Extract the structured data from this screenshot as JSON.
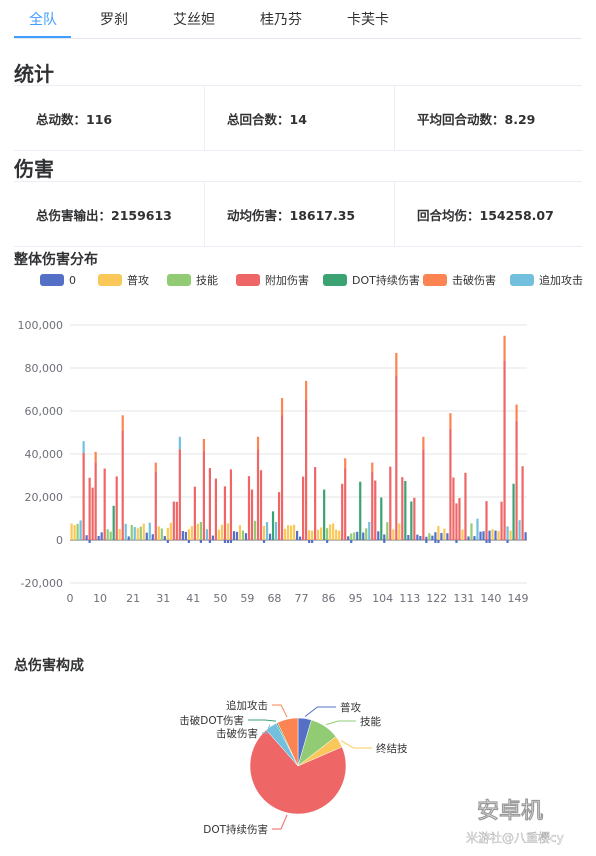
{
  "tabs": [
    "全队",
    "罗刹",
    "艾丝妲",
    "桂乃芬",
    "卡芙卡"
  ],
  "stats_title": "统计",
  "stats": [
    "总动数：116",
    "总回合数：14",
    "平均回合动数：8.29"
  ],
  "damage_title": "伤害",
  "damage_stats": [
    "总伤害输出：2159613",
    "动均伤害：18617.35",
    "回合均伤：154258.07"
  ],
  "bar_title": "整体伤害分布",
  "pie_title": "总伤害构成",
  "watermark": {
    "brand": "安卓机",
    "sub": "米游社@八重樱cy"
  },
  "chart_data": [
    {
      "type": "bar",
      "stacked": true,
      "legend": [
        {
          "name": "0",
          "color": "#5470c6"
        },
        {
          "name": "普攻",
          "color": "#fac858"
        },
        {
          "name": "技能",
          "color": "#91cc75"
        },
        {
          "name": "附加伤害",
          "color": "#ee6666"
        },
        {
          "name": "DOT持续伤害",
          "color": "#3ba272"
        },
        {
          "name": "击破伤害",
          "color": "#fc8452"
        },
        {
          "name": "追加攻击",
          "color": "#73c0de"
        }
      ],
      "legend_position": "top",
      "ylim": [
        -20000,
        100000
      ],
      "yticks": [
        "100,000",
        "80,000",
        "60,000",
        "40,000",
        "20,000",
        "0",
        "-20,000"
      ],
      "xticks": [
        "0",
        "10",
        "21",
        "31",
        "41",
        "50",
        "59",
        "68",
        "77",
        "86",
        "95",
        "104",
        "113",
        "122",
        "131",
        "140",
        "149"
      ],
      "grid": true,
      "peaks": [
        {
          "x": 4,
          "value": 46000,
          "series": "追加攻击"
        },
        {
          "x": 8,
          "value": 41000,
          "series": "附加伤害"
        },
        {
          "x": 17,
          "value": 58000,
          "series": "附加伤害"
        },
        {
          "x": 28,
          "value": 36000,
          "series": "附加伤害"
        },
        {
          "x": 36,
          "value": 48000,
          "series": "追加攻击"
        },
        {
          "x": 44,
          "value": 47000,
          "series": "附加伤害"
        },
        {
          "x": 62,
          "value": 48000,
          "series": "附加伤害"
        },
        {
          "x": 70,
          "value": 66000,
          "series": "附加伤害"
        },
        {
          "x": 78,
          "value": 74000,
          "series": "附加伤害"
        },
        {
          "x": 91,
          "value": 38000,
          "series": "附加伤害"
        },
        {
          "x": 100,
          "value": 36000,
          "series": "附加伤害"
        },
        {
          "x": 108,
          "value": 87000,
          "series": "附加伤害"
        },
        {
          "x": 117,
          "value": 48000,
          "series": "附加伤害"
        },
        {
          "x": 126,
          "value": 59000,
          "series": "附加伤害"
        },
        {
          "x": 144,
          "value": 95000,
          "series": "附加伤害"
        },
        {
          "x": 148,
          "value": 63000,
          "series": "附加伤害"
        }
      ]
    },
    {
      "type": "pie",
      "slices": [
        {
          "name": "普攻",
          "value": 0.045,
          "color": "#5470c6"
        },
        {
          "name": "技能",
          "value": 0.1,
          "color": "#91cc75"
        },
        {
          "name": "终结技",
          "value": 0.04,
          "color": "#fac858"
        },
        {
          "name": "DOT持续伤害",
          "value": 0.7,
          "color": "#ee6666"
        },
        {
          "name": "击破伤害",
          "value": 0.04,
          "color": "#73c0de"
        },
        {
          "name": "击破DOT伤害",
          "value": 0.005,
          "color": "#3ba272"
        },
        {
          "name": "追加攻击",
          "value": 0.07,
          "color": "#fc8452"
        }
      ]
    }
  ]
}
